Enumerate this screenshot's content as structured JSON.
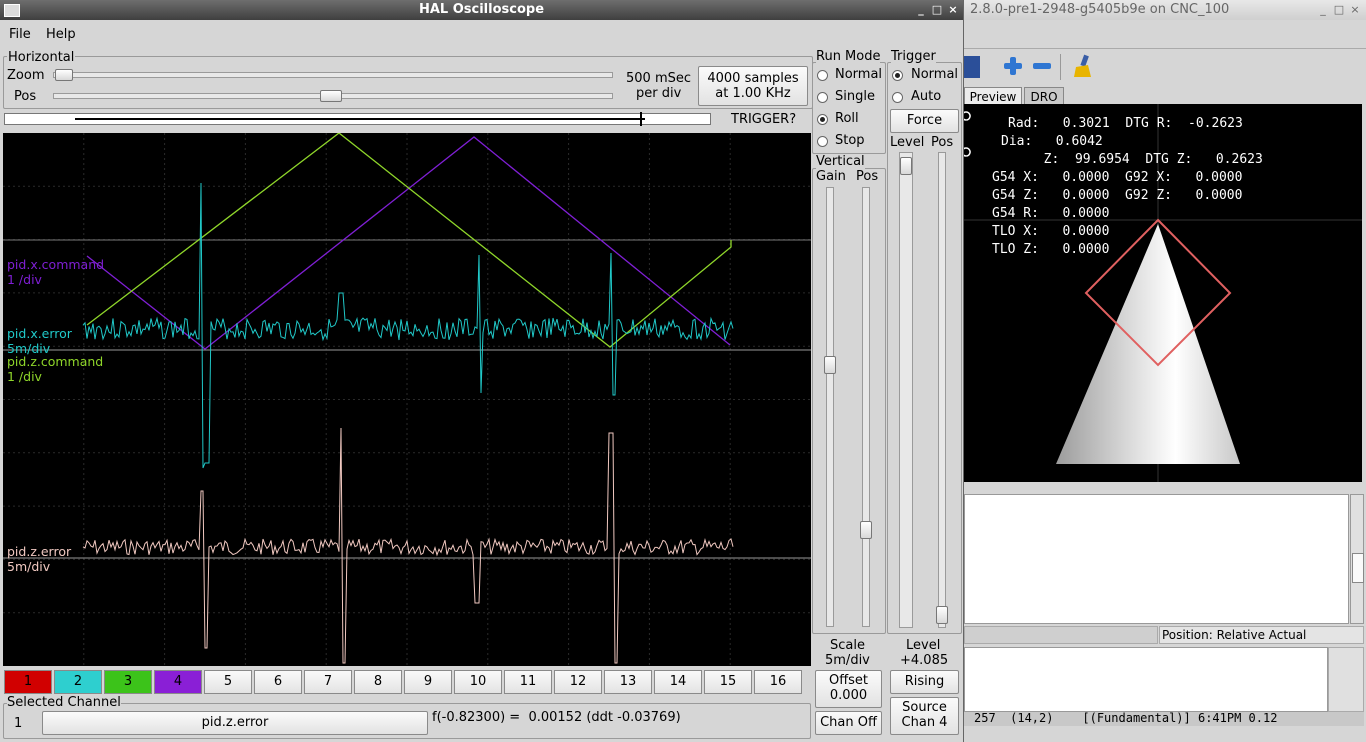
{
  "hal": {
    "title": "HAL Oscilloscope",
    "menu": [
      "File",
      "Help"
    ],
    "horizontal": {
      "label": "Horizontal",
      "zoom_label": "Zoom",
      "pos_label": "Pos",
      "rate_line1": "500 mSec",
      "rate_line2": "per div",
      "samples_line1": "4000 samples",
      "samples_line2": "at 1.00 KHz",
      "trigger_status": "TRIGGER?"
    },
    "run_mode": {
      "label": "Run Mode",
      "options": [
        "Normal",
        "Single",
        "Roll",
        "Stop"
      ],
      "selected": "Roll"
    },
    "trigger": {
      "label": "Trigger",
      "options": [
        "Normal",
        "Auto"
      ],
      "selected": "Normal",
      "force_label": "Force",
      "level_label": "Level",
      "pos_label": "Pos",
      "level_title": "Level",
      "level_value": "+4.085",
      "edge_label": "Rising",
      "source_line1": "Source",
      "source_line2": "Chan  4"
    },
    "vertical": {
      "label": "Vertical",
      "gain_label": "Gain",
      "pos_label": "Pos",
      "scale_label": "Scale",
      "scale_value": "5m/div",
      "offset_label": "Offset",
      "offset_value": "0.000",
      "chan_off_label": "Chan Off"
    },
    "traces": [
      {
        "name": "pid.x.command",
        "scale": "1 /div",
        "color": "#7f1fd4"
      },
      {
        "name": "pid.x.error",
        "scale": "5m/div",
        "color": "#20c8c8"
      },
      {
        "name": "pid.z.command",
        "scale": "1 /div",
        "color": "#8fd62a"
      },
      {
        "name": "pid.z.error",
        "scale": "5m/div",
        "color": "#f0c8c0"
      }
    ],
    "channels": [
      {
        "label": "1",
        "color": "#d10000"
      },
      {
        "label": "2",
        "color": "#2ecfcf"
      },
      {
        "label": "3",
        "color": "#3cc31a"
      },
      {
        "label": "4",
        "color": "#8a1fd6"
      },
      {
        "label": "5"
      },
      {
        "label": "6"
      },
      {
        "label": "7"
      },
      {
        "label": "8"
      },
      {
        "label": "9"
      },
      {
        "label": "10"
      },
      {
        "label": "11"
      },
      {
        "label": "12"
      },
      {
        "label": "13"
      },
      {
        "label": "14"
      },
      {
        "label": "15"
      },
      {
        "label": "16"
      }
    ],
    "selected_channel": {
      "label": "Selected Channel",
      "number": "1",
      "signal": "pid.z.error",
      "readout": "f(-0.82300) =  0.00152 (ddt -0.03769)"
    }
  },
  "cnc": {
    "title": "2.8.0-pre1-2948-g5405b9e on CNC_100",
    "tabs": [
      "Preview",
      "DRO"
    ],
    "active_tab": "Preview",
    "dro_lines": [
      "Rad:   0.3021  DTG R:  -0.2623",
      "Dia:   0.6042",
      "  Z:  99.6954  DTG Z:   0.2623",
      "G54 X:   0.0000  G92 X:   0.0000",
      "G54 Z:   0.0000  G92 Z:   0.0000",
      "G54 R:   0.0000",
      "TLO X:   0.0000",
      "TLO Z:   0.0000"
    ],
    "position_label": "Position: Relative Actual",
    "status_line": "257  (14,2)    [(Fundamental)] 6:41PM 0.12"
  }
}
